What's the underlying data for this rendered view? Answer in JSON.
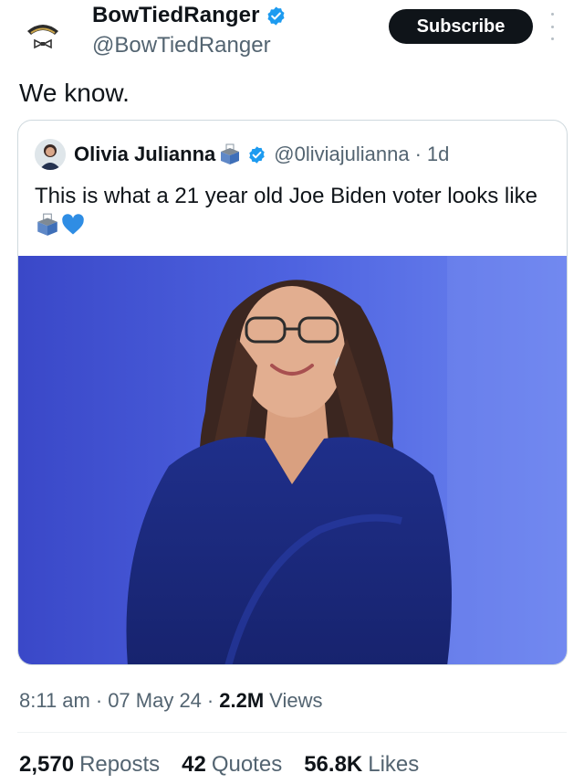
{
  "author": {
    "display_name": "BowTiedRanger",
    "handle": "@BowTiedRanger",
    "verified": true,
    "avatar_icon": "bowtie-ranger-tab-icon"
  },
  "subscribe_label": "Subscribe",
  "tweet_text": "We know.",
  "quoted_tweet": {
    "display_name": "Olivia Julianna",
    "handle": "@0liviajulianna",
    "time": "1d",
    "text": "This is what a 21 year old Joe Biden voter looks like",
    "name_emoji": "ballot-box-icon",
    "text_emojis": [
      "ballot-box-icon",
      "blue-heart-icon"
    ],
    "image_description_icon": "photo-woman-blue-dress"
  },
  "meta": {
    "time": "8:11 am",
    "date": "07 May 24",
    "views_count": "2.2M",
    "views_label": "Views"
  },
  "stats": {
    "reposts_count": "2,570",
    "reposts_label": "Reposts",
    "quotes_count": "42",
    "quotes_label": "Quotes",
    "likes_count": "56.8K",
    "likes_label": "Likes"
  },
  "colors": {
    "verified_blue": "#1d9bf0",
    "text_primary": "#0f1419",
    "text_secondary": "#536471",
    "border": "#cfd9de"
  }
}
